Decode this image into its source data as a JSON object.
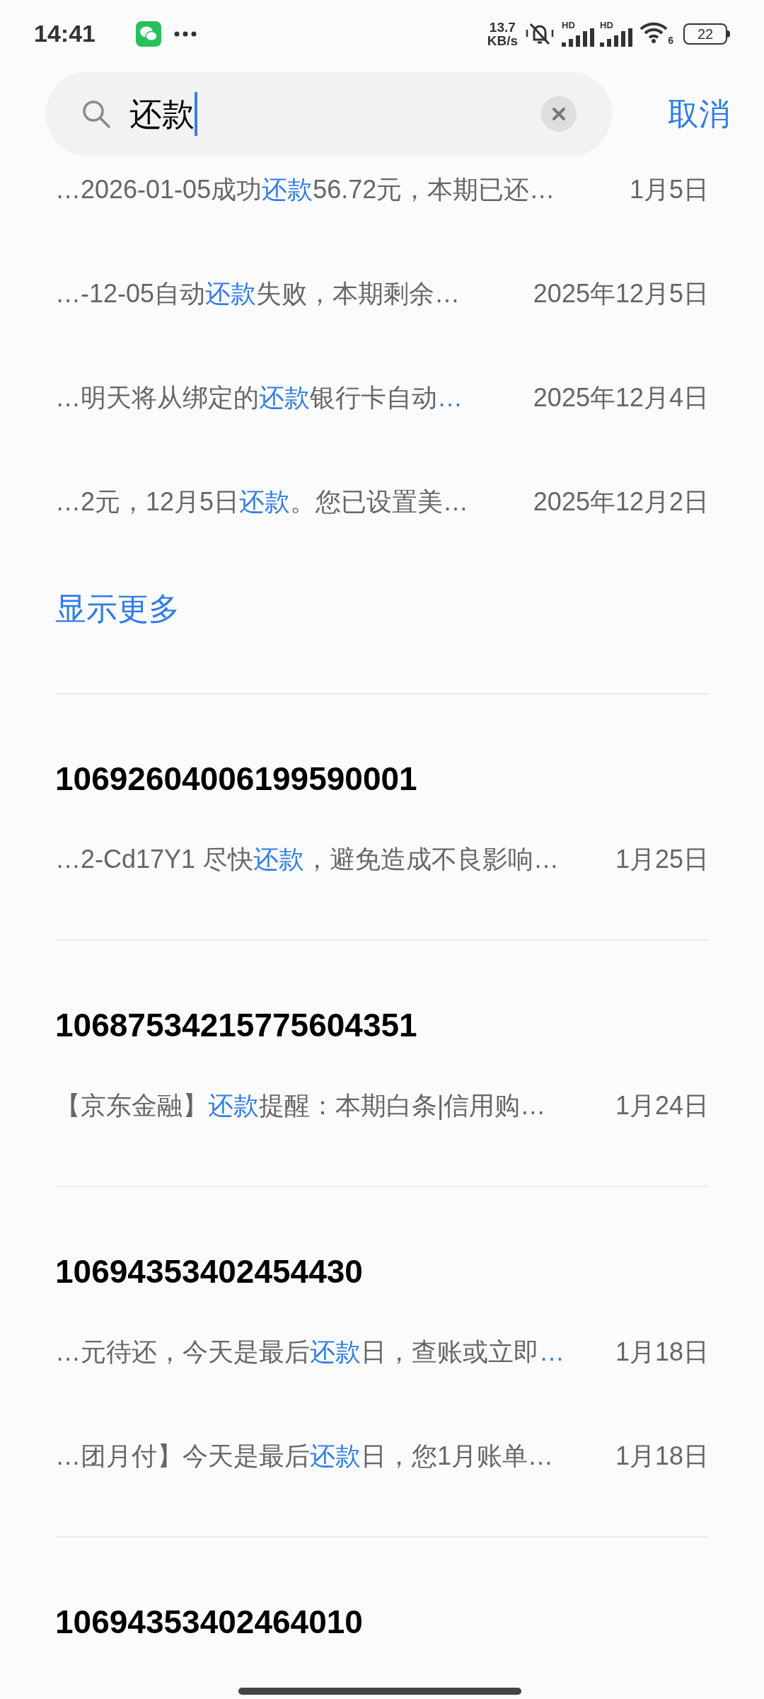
{
  "status_bar": {
    "time": "14:41",
    "network_speed": [
      "13.7",
      "KB/s"
    ],
    "signals": [
      {
        "label": "HD"
      },
      {
        "label": "HD"
      }
    ],
    "wifi_label": "6",
    "battery": "22"
  },
  "search": {
    "value": "还款",
    "cancel": "取消"
  },
  "groups": [
    {
      "results": [
        {
          "parts": [
            {
              "text": "…2026-01-05成功",
              "hit": false
            },
            {
              "text": "还款",
              "hit": true
            },
            {
              "text": "56.72元，本期已还…",
              "hit": false
            }
          ],
          "date": "1月5日"
        },
        {
          "parts": [
            {
              "text": "…-12-05自动",
              "hit": false
            },
            {
              "text": "还款",
              "hit": true
            },
            {
              "text": "失败，本期剩余…",
              "hit": false
            }
          ],
          "date": "2025年12月5日"
        },
        {
          "parts": [
            {
              "text": "…明天将从绑定的",
              "hit": false
            },
            {
              "text": "还款",
              "hit": true
            },
            {
              "text": "银行卡自动",
              "hit": false
            },
            {
              "text": "…",
              "hit": true
            }
          ],
          "date": "2025年12月4日"
        },
        {
          "parts": [
            {
              "text": "…2元，12月5日",
              "hit": false
            },
            {
              "text": "还款",
              "hit": true
            },
            {
              "text": "。您已设置美…",
              "hit": false
            }
          ],
          "date": "2025年12月2日"
        }
      ],
      "show_more": "显示更多"
    },
    {
      "title": "10692604006199590001",
      "results": [
        {
          "parts": [
            {
              "text": "…2-Cd17Y1 尽快",
              "hit": false
            },
            {
              "text": "还款",
              "hit": true
            },
            {
              "text": "，避免造成不良影响…",
              "hit": false
            }
          ],
          "date": "1月25日"
        }
      ]
    },
    {
      "title": "10687534215775604351",
      "results": [
        {
          "parts": [
            {
              "text": "【京东金融】",
              "hit": false
            },
            {
              "text": "还款",
              "hit": true
            },
            {
              "text": "提醒：本期白条|信用购…",
              "hit": false
            }
          ],
          "date": "1月24日"
        }
      ]
    },
    {
      "title": "10694353402454430",
      "results": [
        {
          "parts": [
            {
              "text": "…元待还，今天是最后",
              "hit": false
            },
            {
              "text": "还款",
              "hit": true
            },
            {
              "text": "日，查账或立即",
              "hit": false
            },
            {
              "text": "…",
              "hit": true
            }
          ],
          "date": "1月18日"
        },
        {
          "parts": [
            {
              "text": "…团月付】今天是最后",
              "hit": false
            },
            {
              "text": "还款",
              "hit": true
            },
            {
              "text": "日，您1月账单…",
              "hit": false
            }
          ],
          "date": "1月18日"
        }
      ]
    },
    {
      "title": "10694353402464010"
    }
  ]
}
